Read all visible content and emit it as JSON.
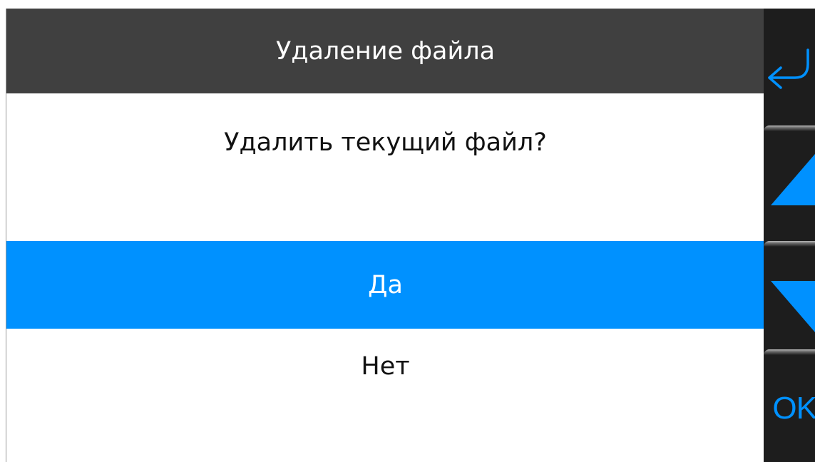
{
  "dialog": {
    "title": "Удаление файла",
    "question": "Удалить текущий файл?",
    "options": [
      {
        "label": "Да",
        "selected": true
      },
      {
        "label": "Нет",
        "selected": false
      }
    ]
  },
  "sidebar": {
    "buttons": [
      {
        "name": "back",
        "icon": "back-arrow-icon"
      },
      {
        "name": "up",
        "icon": "triangle-up-icon"
      },
      {
        "name": "down",
        "icon": "triangle-down-icon"
      },
      {
        "name": "ok",
        "label": "OK"
      }
    ]
  },
  "colors": {
    "accent": "#0091ff",
    "header_bg": "#404040",
    "sidebar_bg": "#1d1d1d",
    "text": "#111111"
  }
}
